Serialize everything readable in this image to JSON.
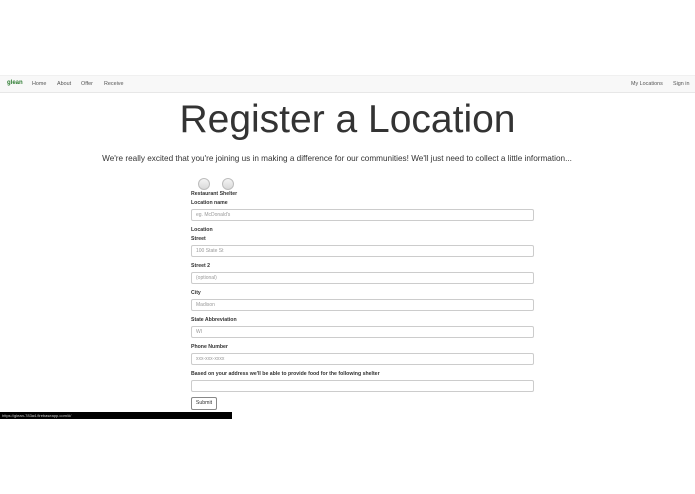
{
  "navbar": {
    "brand": "glean",
    "links": [
      "Home",
      "About",
      "Offer",
      "Receive"
    ],
    "right_links": [
      "My Locations",
      "Sign in"
    ]
  },
  "main": {
    "title": "Register a Location",
    "subtitle": "We're really excited that you're joining us in making a difference for our communities! We'll just need to collect a little information...",
    "type_options": [
      "Restaurant",
      "Shelter"
    ]
  },
  "form": {
    "location_name_label": "Location name",
    "location_name_placeholder": "eg. McDonald's",
    "location_section_label": "Location",
    "street_label": "Street",
    "street_placeholder": "100 State St",
    "street2_label": "Street 2",
    "street2_placeholder": "(optional)",
    "city_label": "City",
    "city_placeholder": "Madison",
    "state_label": "State Abbreviation",
    "state_placeholder": "WI",
    "phone_label": "Phone Number",
    "phone_placeholder": "xxx-xxx-xxxx",
    "shelter_label": "Based on your address we'll be able to provide food for the following shelter",
    "shelter_value": "",
    "submit_label": "Submit"
  },
  "status_bar": {
    "url": "https://glean-783a4.firebaseapp.com/#/"
  }
}
